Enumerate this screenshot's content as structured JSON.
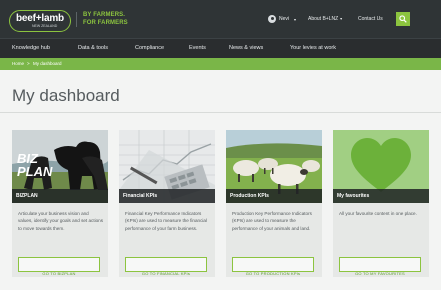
{
  "header": {
    "logo_text": "beef+lamb",
    "logo_sub": "NEW ZEALAND",
    "tagline_line1": "BY FARMERS.",
    "tagline_line2": "FOR FARMERS",
    "user_name": "Nevi",
    "about_label": "About B+LNZ",
    "contact_label": "Contact Us",
    "accent_color": "#8cc43f",
    "header_color": "#2f3436"
  },
  "nav": {
    "items": [
      "Knowledge hub",
      "Data & tools",
      "Compliance",
      "Events",
      "News & views",
      "Your levies at work"
    ]
  },
  "breadcrumb": {
    "home": "Home",
    "separator": ">",
    "current": "My dashboard"
  },
  "page": {
    "title": "My dashboard"
  },
  "cards": [
    {
      "label": "BIZPLAN",
      "image_text_1": "BIZ",
      "image_text_2": "PLAN",
      "description": "Articulate your business vision and values, identify your goals and set actions to move towards them.",
      "button": "GO TO BIZPLAN"
    },
    {
      "label": "Financial KPIs",
      "description": "Financial Key Performance Indicators (KPIs) are used to measure the financial performance of your farm business.",
      "button": "GO TO FINANCIAL KPIs"
    },
    {
      "label": "Production KPIs",
      "description": "Production Key Performance Indicators (KPIs) are used to measure the performance of your animals and land.",
      "button": "GO TO PRODUCTION KPIs"
    },
    {
      "label": "My favourites",
      "description": "All your favourite content in one place.",
      "button": "GO TO MY FAVOURITES"
    }
  ]
}
